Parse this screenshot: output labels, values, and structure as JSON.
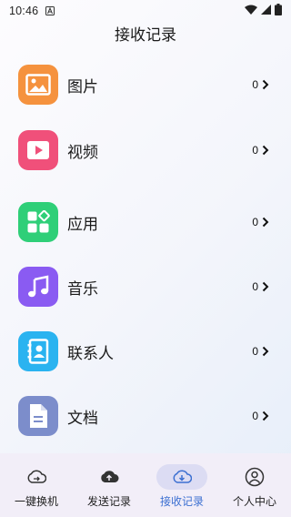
{
  "status_bar": {
    "time": "10:46",
    "icons": [
      "notification-a-icon",
      "wifi-icon",
      "signal-icon",
      "battery-icon"
    ]
  },
  "header": {
    "title": "接收记录"
  },
  "records": [
    {
      "label": "图片",
      "count": "0",
      "icon": "image-icon",
      "color": "#f5923e"
    },
    {
      "label": "视频",
      "count": "0",
      "icon": "video-play-icon",
      "color": "#f0507a"
    },
    {
      "label": "应用",
      "count": "0",
      "icon": "apps-grid-icon",
      "color": "#2fcf78"
    },
    {
      "label": "音乐",
      "count": "0",
      "icon": "music-note-icon",
      "color": "#8a5bf2"
    },
    {
      "label": "联系人",
      "count": "0",
      "icon": "contacts-book-icon",
      "color": "#2ab3f0"
    },
    {
      "label": "文档",
      "count": "0",
      "icon": "document-icon",
      "color": "#7c8dcb"
    }
  ],
  "tabs": [
    {
      "label": "一键换机",
      "icon": "cloud-sync-icon",
      "active": false
    },
    {
      "label": "发送记录",
      "icon": "cloud-upload-icon",
      "active": false
    },
    {
      "label": "接收记录",
      "icon": "cloud-download-icon",
      "active": true,
      "accent": "#3b6fd1"
    },
    {
      "label": "个人中心",
      "icon": "person-icon",
      "active": false
    }
  ]
}
